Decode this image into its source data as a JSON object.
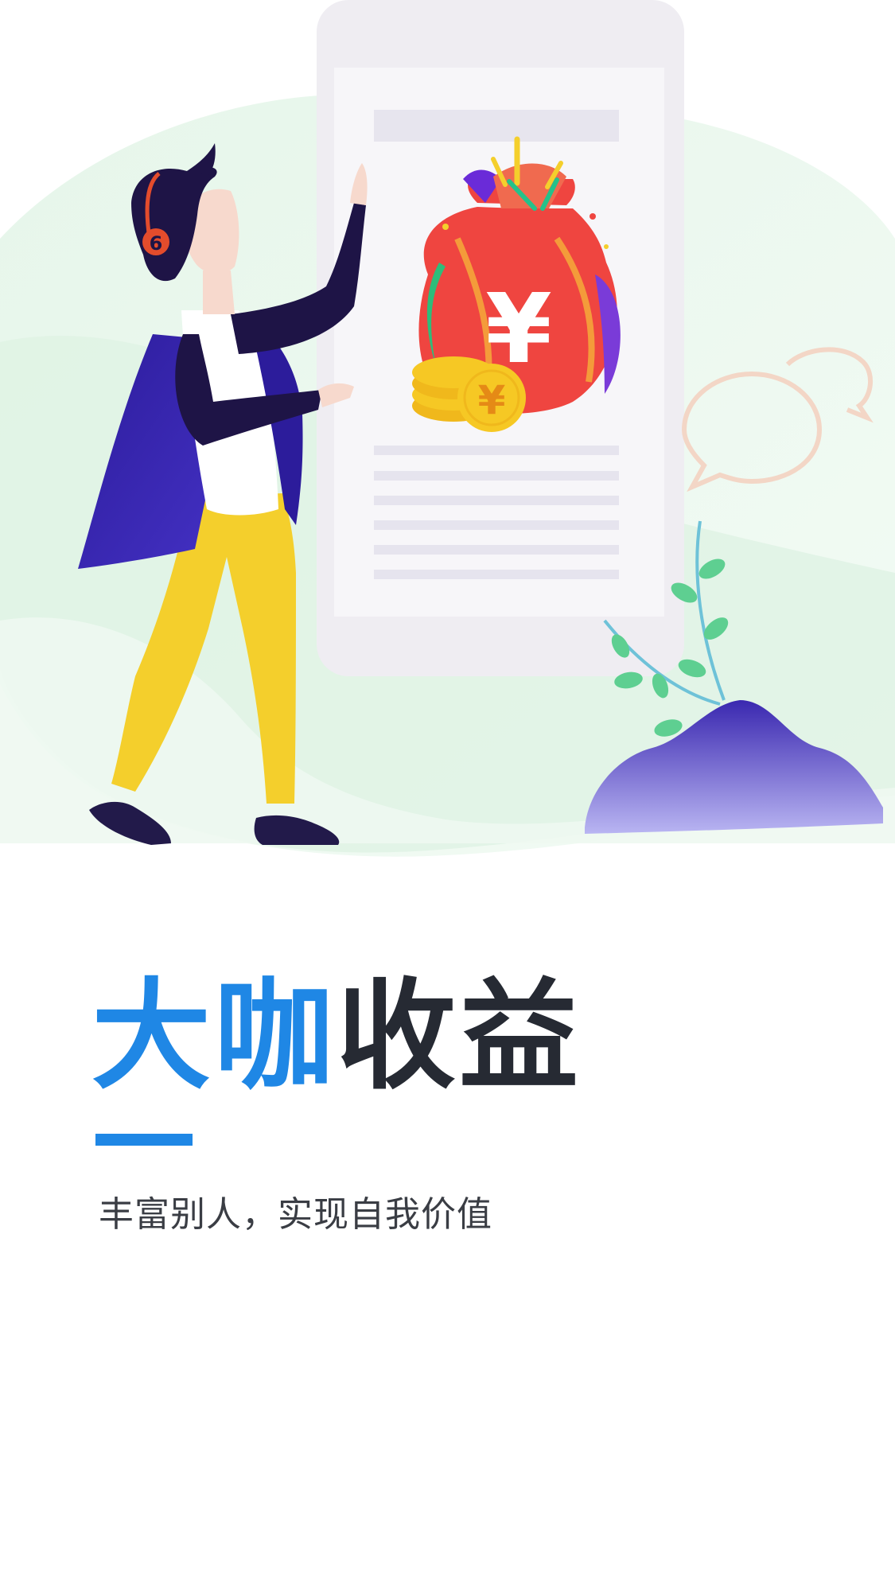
{
  "onboarding": {
    "title_accent": "大咖",
    "title_rest": "收益",
    "subtitle": "丰富别人，实现自我价值"
  },
  "illustration": {
    "headphone_badge": "6",
    "bag_symbol": "¥",
    "coin_symbol": "¥"
  },
  "colors": {
    "accent": "#1f87e5",
    "title_dark": "#262a33",
    "subtitle": "#3a3d44",
    "bag_red": "#ef4540",
    "coin_gold": "#f6c824",
    "jacket_purple": "#2c1c9b",
    "pants_yellow": "#f4cf2c"
  }
}
